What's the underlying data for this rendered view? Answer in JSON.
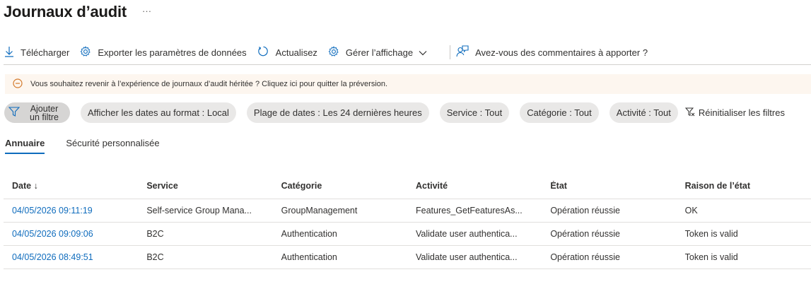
{
  "title": "Journaux d’audit",
  "more": "···",
  "toolbar": {
    "download": "Télécharger",
    "export": "Exporter les paramètres de données",
    "refresh": "Actualisez",
    "manage_view": "Gérer l’affichage",
    "feedback": "Avez-vous des commentaires à apporter ?"
  },
  "banner": {
    "text": "Vous souhaitez revenir à l’expérience de journaux d’audit héritée ? Cliquez ici pour quitter la préversion."
  },
  "filters": {
    "add_line1": "Ajouter",
    "add_line2": "un filtre",
    "date_format": "Afficher les dates au format : Local",
    "date_range": "Plage de dates : Les 24 dernières heures",
    "service": "Service : Tout",
    "category": "Catégorie : Tout",
    "activity": "Activité : Tout",
    "reset": "Réinitialiser les filtres"
  },
  "tabs": [
    "Annuaire",
    "Sécurité personnalisée"
  ],
  "table": {
    "columns": [
      "Date ↓",
      "Service",
      "Catégorie",
      "Activité",
      "État",
      "Raison de l’état"
    ],
    "rows": [
      [
        "04/05/2026 09:11:19",
        "Self-service Group Mana...",
        "GroupManagement",
        "Features_GetFeaturesAs...",
        "Opération réussie",
        "OK"
      ],
      [
        "04/05/2026 09:09:06",
        "B2C",
        "Authentication",
        "Validate user authentica...",
        "Opération réussie",
        "Token is valid"
      ],
      [
        "04/05/2026 08:49:51",
        "B2C",
        "Authentication",
        "Validate user authentica...",
        "Opération réussie",
        "Token is valid"
      ]
    ]
  },
  "colors": {
    "accent": "#0f6cbd",
    "banner_bg": "#fdf6ef",
    "banner_icon": "#d47a2c",
    "pill_bg": "#e9e8e7"
  }
}
